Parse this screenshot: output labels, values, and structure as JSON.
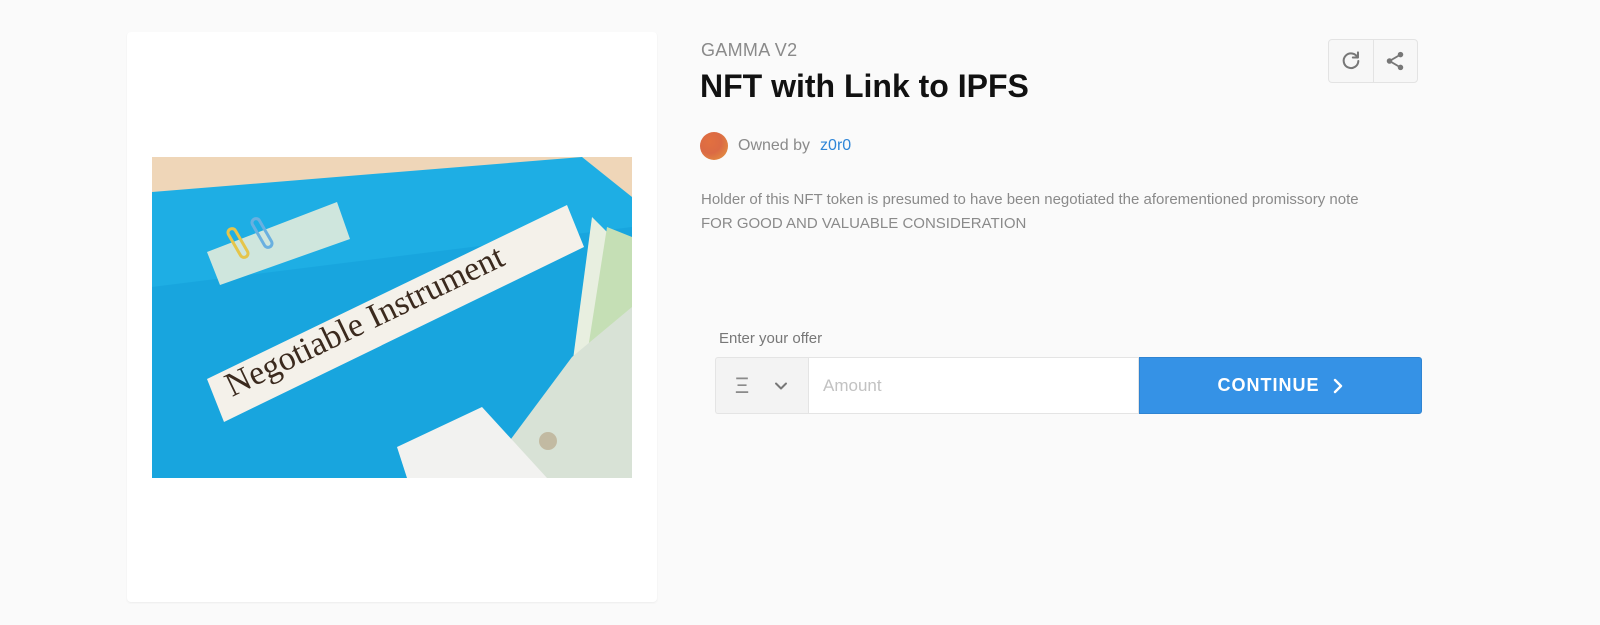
{
  "item": {
    "collection": "GAMMA V2",
    "title": "NFT with Link to IPFS",
    "image_caption": "Negotiable Instrument",
    "image_icon": "nft-artwork-image"
  },
  "owner": {
    "prefix": "Owned by",
    "name": "z0r0"
  },
  "description": {
    "line1": "Holder of this NFT token is presumed to have been negotiated the aforementioned promissory note",
    "line2": "FOR GOOD AND VALUABLE CONSIDERATION"
  },
  "actions": {
    "refresh_icon": "refresh-icon",
    "share_icon": "share-icon"
  },
  "offer": {
    "label": "Enter your offer",
    "currency_symbol": "Ξ",
    "amount_placeholder": "Amount",
    "continue_label": "CONTINUE"
  },
  "colors": {
    "accent": "#3592e6",
    "link": "#2f86d8",
    "muted_text": "#8a8a8a",
    "background": "#fafafa"
  }
}
